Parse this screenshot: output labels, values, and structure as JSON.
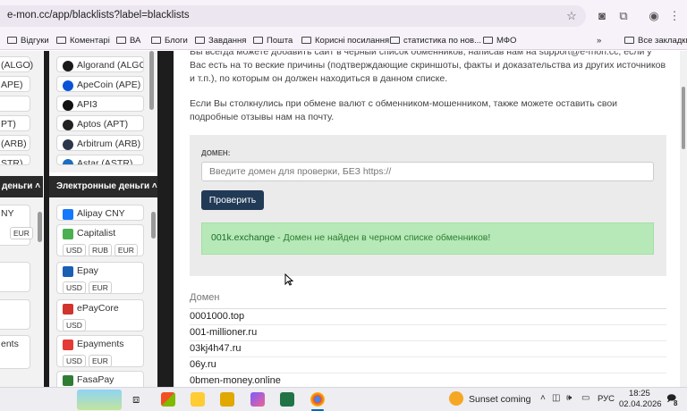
{
  "browser": {
    "url": "e-mon.cc/app/blacklists?label=blacklists",
    "bookmarks": [
      "Відгуки",
      "Коментарі",
      "ВА",
      "Блоги",
      "Завдання",
      "Пошта",
      "Корисні посилання",
      "статистика по нов...",
      "МФО"
    ],
    "all_bookmarks_label": "Все закладки",
    "more_label": "»"
  },
  "left_partial": {
    "coins": [
      "(ALGO)",
      "APE)",
      "",
      "PT)",
      "(ARB)",
      "STR)"
    ],
    "header": "деньги",
    "items": [
      "NY",
      "",
      "",
      "",
      "ents",
      ""
    ],
    "item_tags": [
      "EUR"
    ]
  },
  "crypto_column": {
    "items": [
      {
        "name": "Algorand (ALGO)",
        "color": "#1a1a1a"
      },
      {
        "name": "ApeCoin (APE)",
        "color": "#0a53d6"
      },
      {
        "name": "API3",
        "color": "#111111"
      },
      {
        "name": "Aptos (APT)",
        "color": "#222222"
      },
      {
        "name": "Arbitrum (ARB)",
        "color": "#2d374b"
      },
      {
        "name": "Astar (ASTR)",
        "color": "#1b6dc1"
      }
    ]
  },
  "emoney_column": {
    "header": "Электронные деньги",
    "items": [
      {
        "name": "Alipay CNY",
        "color": "#1677ff",
        "tags": []
      },
      {
        "name": "Capitalist",
        "color": "#4caf50",
        "tags": [
          "USD",
          "RUB",
          "EUR"
        ]
      },
      {
        "name": "Epay",
        "color": "#1a5fb4",
        "tags": [
          "USD",
          "EUR"
        ]
      },
      {
        "name": "ePayCore",
        "color": "#d0342c",
        "tags": [
          "USD"
        ]
      },
      {
        "name": "Epayments",
        "color": "#e53935",
        "tags": [
          "USD",
          "EUR"
        ]
      },
      {
        "name": "FasaPay",
        "color": "#2e7d32",
        "tags": []
      }
    ]
  },
  "content": {
    "para1_line1": "Вы всегда можете добавить сайт в черный список обменников, написав нам на support@e-mon.cc, если у",
    "para1_line2": "Вас есть на то веские причины (подтверждающие скриншоты, факты и доказательства из других источников",
    "para1_line3": "и т.п.), по которым он должен находиться в данном списке.",
    "para2_line1": "Если Вы столкнулись при обмене валют с обменником-мошенником, также можете оставить свои",
    "para2_line2": "подробные отзывы нам на почту.",
    "domain_label": "ДОМЕН:",
    "domain_placeholder": "Введите домен для проверки, БЕЗ https://",
    "check_button": "Проверить",
    "result_domain": "001k.exchange",
    "result_text": " - Домен не найден в черном списке обменников!",
    "table_header": "Домен",
    "domains": [
      "0001000.top",
      "001-millioner.ru",
      "03kj4h47.ru",
      "06y.ru",
      "0bmen-money.online"
    ]
  },
  "taskbar": {
    "weather": "Sunset coming",
    "lang": "РУС",
    "time": "18:25",
    "date": "02.04.2026",
    "notifications": "8"
  }
}
